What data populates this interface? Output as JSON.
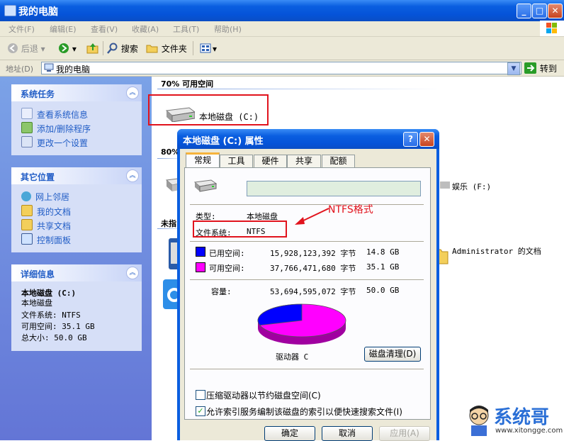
{
  "window": {
    "title": "我的电脑"
  },
  "menu": [
    "文件(F)",
    "编辑(E)",
    "查看(V)",
    "收藏(A)",
    "工具(T)",
    "帮助(H)"
  ],
  "toolbar": {
    "back": "后退",
    "search": "搜索",
    "folders": "文件夹"
  },
  "address": {
    "label": "地址(D)",
    "value": "我的电脑",
    "go": "转到"
  },
  "sidebar": {
    "system_tasks": {
      "title": "系统任务",
      "items": [
        "查看系统信息",
        "添加/删除程序",
        "更改一个设置"
      ]
    },
    "other_places": {
      "title": "其它位置",
      "items": [
        "网上邻居",
        "我的文档",
        "共享文档",
        "控制面板"
      ]
    },
    "details": {
      "title": "详细信息",
      "name": "本地磁盘 (C:)",
      "type": "本地磁盘",
      "fs": "文件系统: NTFS",
      "free": "可用空间: 35.1 GB",
      "total": "总大小: 50.0 GB"
    }
  },
  "main": {
    "section1": "70% 可用空间",
    "section2": "80%",
    "section3": "未指",
    "drive_c": "本地磁盘 (C:)",
    "drive_f": "娱乐 (F:)",
    "admin_docs": "Administrator 的文档"
  },
  "dialog": {
    "title": "本地磁盘 (C:) 属性",
    "tabs": [
      "常规",
      "工具",
      "硬件",
      "共享",
      "配额"
    ],
    "type_label": "类型:",
    "type_value": "本地磁盘",
    "fs_label": "文件系统:",
    "fs_value": "NTFS",
    "used_label": "已用空间:",
    "used_bytes": "15,928,123,392 字节",
    "used_gb": "14.8 GB",
    "free_label": "可用空间:",
    "free_bytes": "37,766,471,680 字节",
    "free_gb": "35.1 GB",
    "cap_label": "容量:",
    "cap_bytes": "53,694,595,072 字节",
    "cap_gb": "50.0 GB",
    "drive_label": "驱动器 C",
    "cleanup": "磁盘清理(D)",
    "compress": "压缩驱动器以节约磁盘空间(C)",
    "index": "允许索引服务编制该磁盘的索引以便快速搜索文件(I)",
    "ok": "确定",
    "cancel": "取消",
    "apply": "应用(A)",
    "used_fraction": 0.297,
    "colors": {
      "used": "#0000ff",
      "free": "#ff00ff"
    }
  },
  "annotation": "NTFS格式",
  "watermark": {
    "brand": "系统哥",
    "url": "www.xitongge.com"
  }
}
